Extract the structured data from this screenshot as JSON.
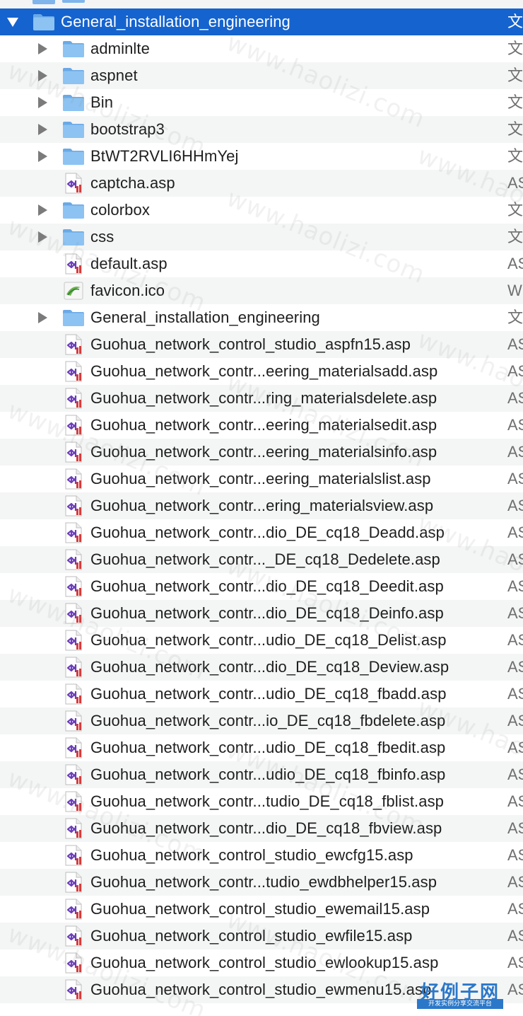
{
  "colors": {
    "selection": "#1563ce",
    "folder": "#7fb5ea",
    "alt_row": "#f4f5f5",
    "asp_purple": "#6c3fb8",
    "asp_red": "#d63b3b"
  },
  "watermark": {
    "text": "www.haolizi.com",
    "logo_main": "好例子网",
    "logo_sub": "开发实例分享交流平台"
  },
  "rows": [
    {
      "indent": 0,
      "expanded": true,
      "icon": "folder-icon",
      "name": "General_installation_engineering",
      "kind": "文",
      "selected": true
    },
    {
      "indent": 1,
      "expanded": false,
      "icon": "folder-icon",
      "name": "adminlte",
      "kind": "文"
    },
    {
      "indent": 1,
      "expanded": false,
      "icon": "folder-icon",
      "name": "aspnet",
      "kind": "文"
    },
    {
      "indent": 1,
      "expanded": false,
      "icon": "folder-icon",
      "name": "Bin",
      "kind": "文"
    },
    {
      "indent": 1,
      "expanded": false,
      "icon": "folder-icon",
      "name": "bootstrap3",
      "kind": "文"
    },
    {
      "indent": 1,
      "expanded": false,
      "icon": "folder-icon",
      "name": "BtWT2RVLI6HHmYej",
      "kind": "文"
    },
    {
      "indent": 1,
      "icon": "asp-file-icon",
      "name": "captcha.asp",
      "kind": "AS"
    },
    {
      "indent": 1,
      "expanded": false,
      "icon": "folder-icon",
      "name": "colorbox",
      "kind": "文"
    },
    {
      "indent": 1,
      "expanded": false,
      "icon": "folder-icon",
      "name": "css",
      "kind": "文"
    },
    {
      "indent": 1,
      "icon": "asp-file-icon",
      "name": "default.asp",
      "kind": "AS"
    },
    {
      "indent": 1,
      "icon": "ico-file-icon",
      "name": "favicon.ico",
      "kind": "W"
    },
    {
      "indent": 1,
      "expanded": false,
      "icon": "folder-icon",
      "name": "General_installation_engineering",
      "kind": "文"
    },
    {
      "indent": 1,
      "icon": "asp-file-icon",
      "name": "Guohua_network_control_studio_aspfn15.asp",
      "kind": "AS"
    },
    {
      "indent": 1,
      "icon": "asp-file-icon",
      "name": "Guohua_network_contr...eering_materialsadd.asp",
      "kind": "AS"
    },
    {
      "indent": 1,
      "icon": "asp-file-icon",
      "name": "Guohua_network_contr...ring_materialsdelete.asp",
      "kind": "AS"
    },
    {
      "indent": 1,
      "icon": "asp-file-icon",
      "name": "Guohua_network_contr...eering_materialsedit.asp",
      "kind": "AS"
    },
    {
      "indent": 1,
      "icon": "asp-file-icon",
      "name": "Guohua_network_contr...eering_materialsinfo.asp",
      "kind": "AS"
    },
    {
      "indent": 1,
      "icon": "asp-file-icon",
      "name": "Guohua_network_contr...eering_materialslist.asp",
      "kind": "AS"
    },
    {
      "indent": 1,
      "icon": "asp-file-icon",
      "name": "Guohua_network_contr...ering_materialsview.asp",
      "kind": "AS"
    },
    {
      "indent": 1,
      "icon": "asp-file-icon",
      "name": "Guohua_network_contr...dio_DE_cq18_Deadd.asp",
      "kind": "AS"
    },
    {
      "indent": 1,
      "icon": "asp-file-icon",
      "name": "Guohua_network_contr..._DE_cq18_Dedelete.asp",
      "kind": "AS"
    },
    {
      "indent": 1,
      "icon": "asp-file-icon",
      "name": "Guohua_network_contr...dio_DE_cq18_Deedit.asp",
      "kind": "AS"
    },
    {
      "indent": 1,
      "icon": "asp-file-icon",
      "name": "Guohua_network_contr...dio_DE_cq18_Deinfo.asp",
      "kind": "AS"
    },
    {
      "indent": 1,
      "icon": "asp-file-icon",
      "name": "Guohua_network_contr...udio_DE_cq18_Delist.asp",
      "kind": "AS"
    },
    {
      "indent": 1,
      "icon": "asp-file-icon",
      "name": "Guohua_network_contr...dio_DE_cq18_Deview.asp",
      "kind": "AS"
    },
    {
      "indent": 1,
      "icon": "asp-file-icon",
      "name": "Guohua_network_contr...udio_DE_cq18_fbadd.asp",
      "kind": "AS"
    },
    {
      "indent": 1,
      "icon": "asp-file-icon",
      "name": "Guohua_network_contr...io_DE_cq18_fbdelete.asp",
      "kind": "AS"
    },
    {
      "indent": 1,
      "icon": "asp-file-icon",
      "name": "Guohua_network_contr...udio_DE_cq18_fbedit.asp",
      "kind": "AS"
    },
    {
      "indent": 1,
      "icon": "asp-file-icon",
      "name": "Guohua_network_contr...udio_DE_cq18_fbinfo.asp",
      "kind": "AS"
    },
    {
      "indent": 1,
      "icon": "asp-file-icon",
      "name": "Guohua_network_contr...tudio_DE_cq18_fblist.asp",
      "kind": "AS"
    },
    {
      "indent": 1,
      "icon": "asp-file-icon",
      "name": "Guohua_network_contr...dio_DE_cq18_fbview.asp",
      "kind": "AS"
    },
    {
      "indent": 1,
      "icon": "asp-file-icon",
      "name": "Guohua_network_control_studio_ewcfg15.asp",
      "kind": "AS"
    },
    {
      "indent": 1,
      "icon": "asp-file-icon",
      "name": "Guohua_network_contr...tudio_ewdbhelper15.asp",
      "kind": "AS"
    },
    {
      "indent": 1,
      "icon": "asp-file-icon",
      "name": "Guohua_network_control_studio_ewemail15.asp",
      "kind": "AS"
    },
    {
      "indent": 1,
      "icon": "asp-file-icon",
      "name": "Guohua_network_control_studio_ewfile15.asp",
      "kind": "AS"
    },
    {
      "indent": 1,
      "icon": "asp-file-icon",
      "name": "Guohua_network_control_studio_ewlookup15.asp",
      "kind": "AS"
    },
    {
      "indent": 1,
      "icon": "asp-file-icon",
      "name": "Guohua_network_control_studio_ewmenu15.asp",
      "kind": "AS"
    }
  ]
}
